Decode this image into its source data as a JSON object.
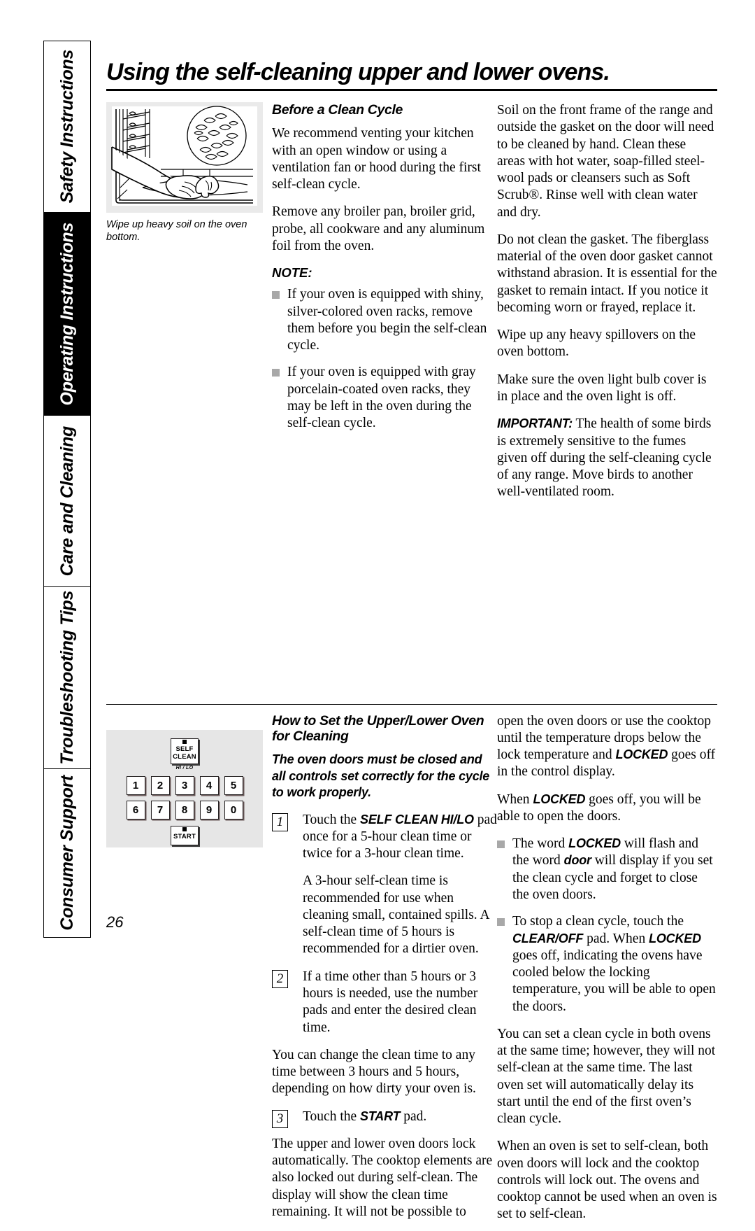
{
  "sidebar": {
    "tabs": [
      {
        "label": "Safety Instructions",
        "active": false
      },
      {
        "label": "Operating Instructions",
        "active": true
      },
      {
        "label": "Care and Cleaning",
        "active": false
      },
      {
        "label": "Troubleshooting Tips",
        "active": false
      },
      {
        "label": "Consumer Support",
        "active": false
      }
    ]
  },
  "page": {
    "title": "Using the self-cleaning upper and lower ovens.",
    "number": "26"
  },
  "figure": {
    "caption": "Wipe up heavy soil on the oven bottom.",
    "alt_name": "oven-bottom-wipe-illustration"
  },
  "section1": {
    "heading": "Before a Clean Cycle",
    "left_paragraphs": [
      "We recommend venting your kitchen with an open window or using a ventilation fan or hood during the first self-clean cycle.",
      "Remove any broiler pan, broiler grid, probe, all cookware and any aluminum foil from the oven."
    ],
    "note_label": "NOTE:",
    "note_items": [
      "If your oven is equipped with shiny, silver-colored oven racks, remove them before you begin the self-clean cycle.",
      "If your oven is equipped with gray porcelain-coated oven racks, they may be left in the oven during the self-clean cycle."
    ],
    "right_paragraphs": [
      "Soil on the front frame of the range and outside the gasket on the door will need to be cleaned by hand. Clean these areas with hot water, soap-filled steel-wool pads or cleansers such as Soft Scrub®. Rinse well with clean water and dry.",
      "Do not clean the gasket. The fiberglass material of the oven door gasket cannot withstand abrasion. It is essential for the gasket to remain intact. If you notice it becoming worn or frayed, replace it.",
      "Wipe up any heavy spillovers on the oven bottom.",
      "Make sure the oven light bulb cover is in place and the oven light is off."
    ],
    "important_label": "IMPORTANT:",
    "important_text": " The health of some birds is extremely sensitive to the fumes given off during the self-cleaning cycle of any range. Move birds to another well-ventilated room."
  },
  "keypad": {
    "self_clean_line1": "SELF",
    "self_clean_line2": "CLEAN",
    "self_clean_sub": "HI / LO",
    "row1": [
      "1",
      "2",
      "3",
      "4",
      "5"
    ],
    "row2": [
      "6",
      "7",
      "8",
      "9",
      "0"
    ],
    "start": "START"
  },
  "section2": {
    "heading": "How to Set the Upper/Lower Oven for Cleaning",
    "intro": "The oven doors must be closed and all controls set correctly for the cycle to work properly.",
    "steps": [
      {
        "number": "1",
        "pre": "Touch the ",
        "emph": "SELF CLEAN HI/LO",
        "post": " pad once for a 5-hour clean time or twice for a 3-hour clean time."
      },
      {
        "number": "2",
        "pre": "If a time other than 5 hours or 3 hours is needed, use the number pads and enter the desired clean time.",
        "emph": "",
        "post": ""
      },
      {
        "number": "3",
        "pre": "Touch the ",
        "emph": "START",
        "post": " pad."
      }
    ],
    "step1_followup": "A 3-hour self-clean time is recommended for use when cleaning small, contained spills. A self-clean time of 5 hours is recommended for a dirtier oven.",
    "step2_followup": "You can change the clean time to any time between 3 hours and 5 hours, depending on how dirty your oven is.",
    "step3_followup_a": "The upper and lower oven doors lock automatically. The cooktop elements are also locked out during self-clean. The display will show the clean time remaining. It will not be possible to",
    "right_continue_pre": "open the oven doors or use the cooktop until the temperature drops below the lock temperature and ",
    "right_continue_emph": "LOCKED",
    "right_continue_post": " goes off in the control display.",
    "right_when_pre": "When ",
    "right_when_emph": "LOCKED",
    "right_when_post": " goes off, you will be able to open the doors.",
    "bullet1_pre": "The word ",
    "bullet1_emph1": "LOCKED",
    "bullet1_mid": " will flash and the word ",
    "bullet1_emph2": "door",
    "bullet1_post": " will display if you set the clean cycle and forget to close the oven doors.",
    "bullet2_pre": "To stop a clean cycle, touch the ",
    "bullet2_emph1": "CLEAR/OFF",
    "bullet2_mid": " pad. When ",
    "bullet2_emph2": "LOCKED",
    "bullet2_post": " goes off, indicating the ovens have cooled below the locking temperature, you will be able to open the doors.",
    "right_paragraphs": [
      "You can set a clean cycle in both ovens at the same time; however, they will not self-clean at the same time. The last oven set will automatically delay its start until the end of the first oven’s clean cycle.",
      "When an oven is set to self-clean, both oven doors will lock and the cooktop controls will lock out. The ovens and cooktop cannot be used when an oven is set to self-clean."
    ]
  }
}
